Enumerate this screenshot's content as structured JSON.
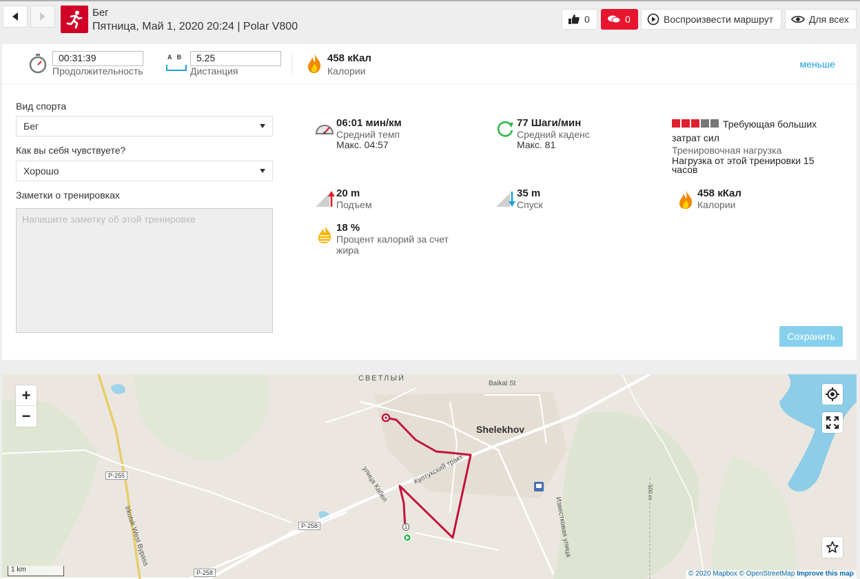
{
  "header": {
    "sport_title": "Бег",
    "subtitle": "Пятница, Май 1, 2020 20:24 | Polar V800",
    "like_count": "0",
    "comment_count": "0",
    "play_route_label": "Воспроизвести маршрут",
    "visibility_label": "Для всех"
  },
  "summary": {
    "duration_value": "00:31:39",
    "duration_label": "Продолжительность",
    "distance_value": "5.25",
    "distance_label": "Дистанция",
    "distance_ab": "A   B",
    "calories_value": "458 кКал",
    "calories_label": "Калории",
    "less_link": "меньше"
  },
  "form": {
    "sport_label": "Вид спорта",
    "sport_value": "Бег",
    "feeling_label": "Как вы себя чувствуете?",
    "feeling_value": "Хорошо",
    "notes_label": "Заметки о тренировках",
    "notes_placeholder": "Напишите заметку об этой тренировке",
    "save_label": "Сохранить"
  },
  "stats": {
    "pace_value": "06:01 мин/км",
    "pace_label": "Средний темп",
    "pace_max": "Макс. 04:57",
    "cadence_value": "77 Шаги/мин",
    "cadence_label": "Средний каденс",
    "cadence_max": "Макс. 81",
    "load_title_1": "Требующая больших",
    "load_title_2": "затрат сил",
    "load_label": "Тренировочная нагрузка",
    "load_desc_1": "Нагрузка от этой тренировки 15",
    "load_desc_2": "часов",
    "load_level": 3,
    "load_max": 5,
    "ascent_value": "20 m",
    "ascent_label": "Подъем",
    "descent_value": "35 m",
    "descent_label": "Спуск",
    "calories_value": "458 кКал",
    "calories_label": "Калории",
    "fat_value": "18 %",
    "fat_label_1": "Процент калорий за счет",
    "fat_label_2": "жира"
  },
  "map": {
    "labels": {
      "svetly": "СВЕТЛЫЙ",
      "baikal": "Baikal St",
      "shelekhov": "Shelekhov",
      "kabel": "улица Кабел",
      "kultuk": "Култукский тракт",
      "izvest": "Известковая улица",
      "bypass": "Irkutsk West Bypass",
      "r255": "Р-255",
      "r258a": "Р-258",
      "r258b": "Р-258",
      "m500": "500 m",
      "start_num": "1"
    },
    "scale_label": "1 km",
    "attrib_mapbox": "© 2020 Mapbox",
    "attrib_osm": "© OpenStreetMap",
    "attrib_improve": "Improve this map"
  },
  "colors": {
    "brand_red": "#d10027",
    "route": "#c0143c",
    "link": "#1aa0e0",
    "save_button": "#86d0ee"
  }
}
